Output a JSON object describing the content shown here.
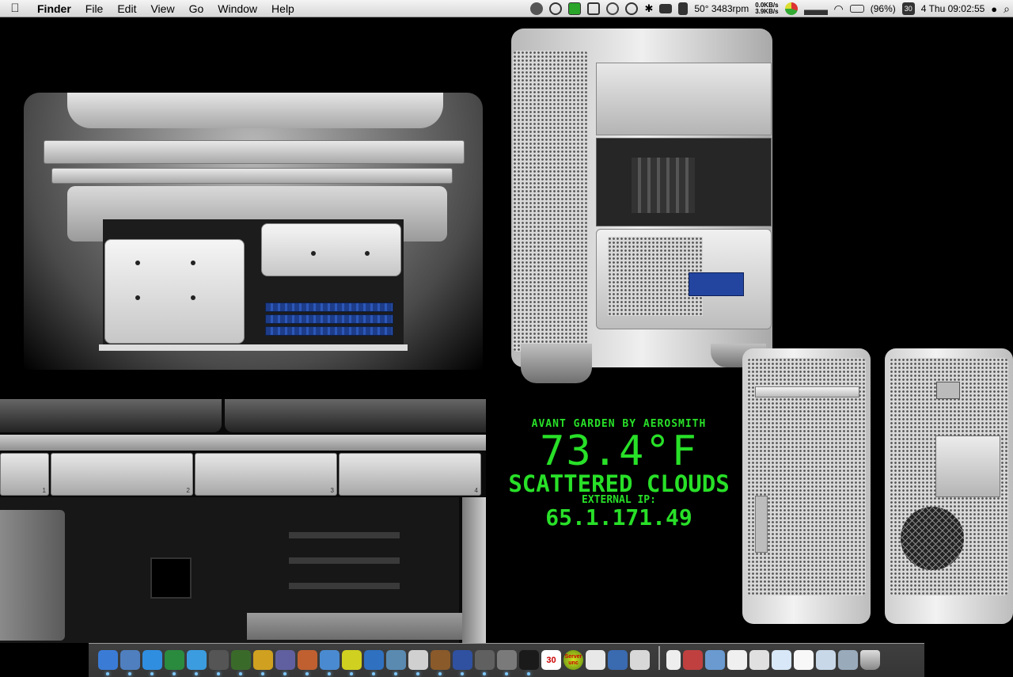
{
  "menubar": {
    "app_name": "Finder",
    "menus": [
      "File",
      "Edit",
      "View",
      "Go",
      "Window",
      "Help"
    ],
    "status": {
      "temp_fan": "50° 3483rpm",
      "net_up": "0.0KB/s",
      "net_down": "3.9KB/s",
      "battery": "(96%)",
      "calendar_day": "30",
      "clock": "4 Thu 09:02:55"
    }
  },
  "widget": {
    "song": "AVANT GARDEN BY AEROSMITH",
    "temperature": "73.4°F",
    "conditions": "SCATTERED CLOUDS",
    "ip_label": "EXTERNAL IP:",
    "ip": "65.1.171.49",
    "color": "#28e028"
  },
  "desktop": {
    "bay_numbers": [
      "1",
      "2",
      "3",
      "4"
    ]
  },
  "dock": {
    "calendar_day": "30",
    "server_label": "Server unc",
    "apps": [
      {
        "icon": "finder-icon",
        "color": "#3a7bd5"
      },
      {
        "icon": "preview-icon",
        "color": "#4f7fbf"
      },
      {
        "icon": "safari-icon",
        "color": "#2f8ee0"
      },
      {
        "icon": "globe-icon",
        "color": "#2a8a3e"
      },
      {
        "icon": "itunes-icon",
        "color": "#3b9ce0"
      },
      {
        "icon": "fan-icon",
        "color": "#555555"
      },
      {
        "icon": "memory-icon",
        "color": "#3a6a2a"
      },
      {
        "icon": "network-icon",
        "color": "#d0a020"
      },
      {
        "icon": "brush-icon",
        "color": "#6060a0"
      },
      {
        "icon": "presentation-icon",
        "color": "#c06030"
      },
      {
        "icon": "chart-icon",
        "color": "#4a8ad0"
      },
      {
        "icon": "pen-icon",
        "color": "#d0d020"
      },
      {
        "icon": "screen-icon",
        "color": "#2f70c0"
      },
      {
        "icon": "photo-icon",
        "color": "#5a8ab0"
      },
      {
        "icon": "capsule-icon",
        "color": "#d0d0d0"
      },
      {
        "icon": "coconut-icon",
        "color": "#8a5a2a"
      },
      {
        "icon": "bbedit-icon",
        "color": "#3050a0"
      },
      {
        "icon": "script-icon",
        "color": "#606060"
      },
      {
        "icon": "gear-icon",
        "color": "#7a7a7a"
      },
      {
        "icon": "terminal-icon",
        "color": "#1a1a1a"
      }
    ]
  }
}
